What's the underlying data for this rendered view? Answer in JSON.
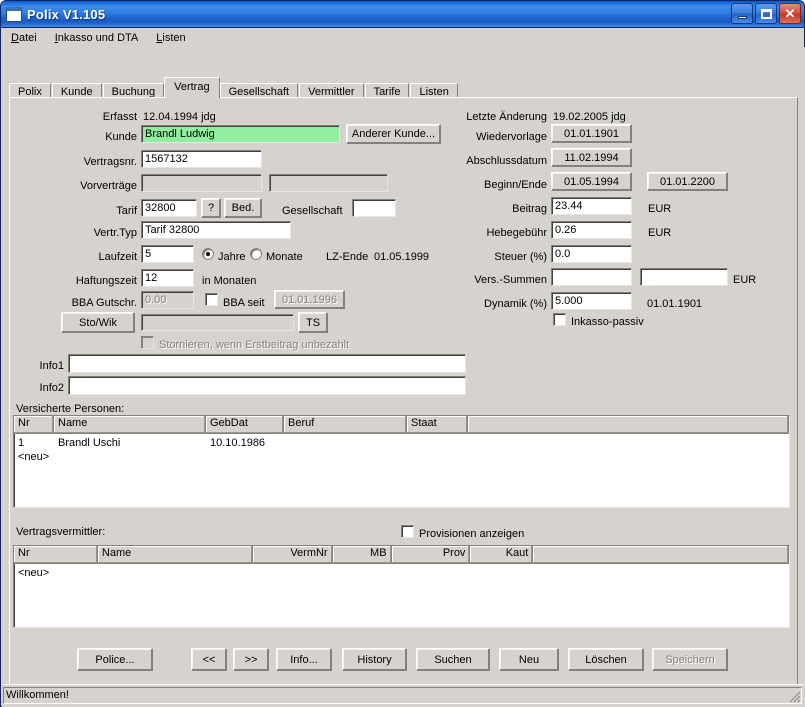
{
  "window": {
    "title": "Polix V1.105",
    "icon": "window-icon",
    "buttons": {
      "minimize": "_",
      "maximize": "□",
      "close": "✕"
    }
  },
  "menubar": {
    "items": [
      {
        "label": "Datei",
        "accel": "D"
      },
      {
        "label": "Inkasso und DTA",
        "accel": "I"
      },
      {
        "label": "Listen",
        "accel": "L"
      }
    ]
  },
  "tabs": {
    "items": [
      "Polix",
      "Kunde",
      "Buchung",
      "Vertrag",
      "Gesellschaft",
      "Vermittler",
      "Tarife",
      "Listen"
    ],
    "active": "Vertrag"
  },
  "form_left": {
    "erfasst_label": "Erfasst",
    "erfasst_value": "12.04.1994  jdg",
    "kunde_label": "Kunde",
    "kunde_value": "Brandl Ludwig",
    "kunde_color": "#90ee9e",
    "anderer_kunde_button": "Anderer Kunde...",
    "vertragsnr_label": "Vertragsnr.",
    "vertragsnr_value": "1567132",
    "vorvertraege_label": "Vorverträge",
    "vorvertraege_value_1": "",
    "vorvertraege_value_2": "",
    "tarif_label": "Tarif",
    "tarif_value": "32800",
    "tarif_help_button": "?",
    "bed_button": "Bed.",
    "gesellschaft_label": "Gesellschaft",
    "gesellschaft_value": "",
    "vertr_typ_label": "Vertr.Typ",
    "vertr_typ_value": "Tarif 32800",
    "laufzeit_label": "Laufzeit",
    "laufzeit_value": "5",
    "radio_jahre": "Jahre",
    "radio_monate": "Monate",
    "radio_selected": "Jahre",
    "lz_ende_label": "LZ-Ende",
    "lz_ende_value": "01.05.1999",
    "haftungszeit_label": "Haftungszeit",
    "haftungszeit_value": "12",
    "haftungszeit_unit": "in Monaten",
    "bba_gutschr_label": "BBA Gutschr.",
    "bba_gutschr_value": "0.00",
    "bba_checkbox_label": "BBA  seit",
    "bba_checked": false,
    "bba_date_button": "01.01.1996",
    "stowik_button": "Sto/Wik",
    "stowik_value": "",
    "ts_button": "TS",
    "stornieren_label": "Stornieren, wenn Erstbeitrag unbezahlt",
    "stornieren_checked": false
  },
  "form_right": {
    "letzte_aenderung_label": "Letzte Änderung",
    "letzte_aenderung_value": "19.02.2005  jdg",
    "wiedervorlage_label": "Wiedervorlage",
    "wiedervorlage_value": "01.01.1901",
    "abschlussdatum_label": "Abschlussdatum",
    "abschlussdatum_value": "11.02.1994",
    "beginn_ende_label": "Beginn/Ende",
    "beginn_value": "01.05.1994",
    "ende_value": "01.01.2200",
    "beitrag_label": "Beitrag",
    "beitrag_value": "23.44",
    "beitrag_currency": "EUR",
    "hebegebuehr_label": "Hebegebühr",
    "hebegebuehr_value": "0.26",
    "hebegebuehr_currency": "EUR",
    "steuer_label": "Steuer (%)",
    "steuer_value": "0.0",
    "vers_summen_label": "Vers.-Summen",
    "vers_summen_value_1": "",
    "vers_summen_value_2": "",
    "vers_summen_currency": "EUR",
    "dynamik_label": "Dynamik (%)",
    "dynamik_value": "5.000",
    "dynamik_date": "01.01.1901",
    "inkasso_passiv_label": "Inkasso-passiv",
    "inkasso_passiv_checked": false
  },
  "info": {
    "info1_label": "Info1",
    "info1_value": "",
    "info2_label": "Info2",
    "info2_value": ""
  },
  "persons": {
    "title": "Versicherte Personen:",
    "columns": [
      "Nr",
      "Name",
      "GebDat",
      "Beruf",
      "Staat",
      ""
    ],
    "rows": [
      {
        "nr": "1",
        "name": "Brandl Uschi",
        "gebdat": "10.10.1986",
        "beruf": "",
        "staat": "",
        "extra": ""
      }
    ],
    "new_row_label": "<neu>"
  },
  "brokers": {
    "title": "Vertragsvermittler:",
    "provisionen_label": "Provisionen anzeigen",
    "provisionen_checked": false,
    "columns": [
      "Nr",
      "Name",
      "VermNr",
      "MB",
      "Prov",
      "Kaut",
      ""
    ],
    "rows": [],
    "new_row_label": "<neu>"
  },
  "bottom_buttons": {
    "police": "Police...",
    "prev": "<<",
    "next": ">>",
    "info": "Info...",
    "history": "History",
    "suchen": "Suchen",
    "neu": "Neu",
    "loeschen": "Löschen",
    "speichern": "Speichern",
    "speichern_disabled": true
  },
  "statusbar": {
    "text": "Willkommen!"
  }
}
